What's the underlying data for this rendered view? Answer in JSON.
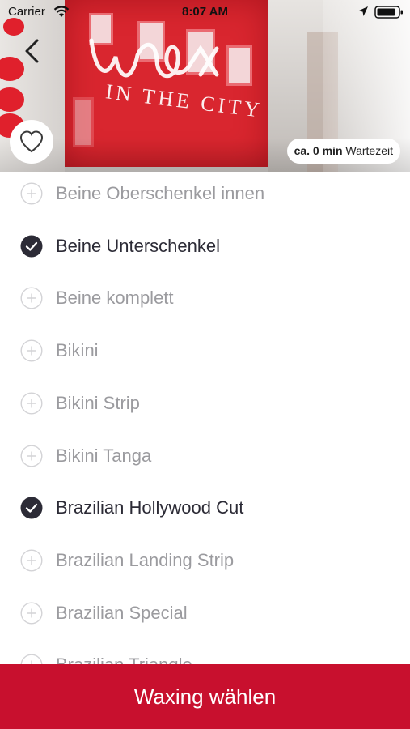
{
  "status_bar": {
    "carrier": "Carrier",
    "time": "8:07 AM",
    "icons": [
      "wifi-icon",
      "location-arrow-icon",
      "battery-icon"
    ]
  },
  "hero": {
    "logo_text": "IN THE CITY",
    "wait_prefix": "ca. 0 min",
    "wait_suffix": "Wartezeit",
    "back_icon": "chevron-left-icon",
    "favorite_icon": "heart-outline-icon"
  },
  "services": [
    {
      "label": "Beine Oberschenkel innen",
      "selected": false
    },
    {
      "label": "Beine Unterschenkel",
      "selected": true
    },
    {
      "label": "Beine komplett",
      "selected": false
    },
    {
      "label": "Bikini",
      "selected": false
    },
    {
      "label": "Bikini Strip",
      "selected": false
    },
    {
      "label": "Bikini Tanga",
      "selected": false
    },
    {
      "label": "Brazilian Hollywood Cut",
      "selected": true
    },
    {
      "label": "Brazilian Landing Strip",
      "selected": false
    },
    {
      "label": "Brazilian Special",
      "selected": false
    },
    {
      "label": "Brazilian Triangle",
      "selected": false
    }
  ],
  "cta": {
    "label": "Waxing wählen"
  },
  "colors": {
    "accent": "#c8102e",
    "selected_check": "#2c2b36",
    "unselected_text": "#9b9b9f"
  }
}
